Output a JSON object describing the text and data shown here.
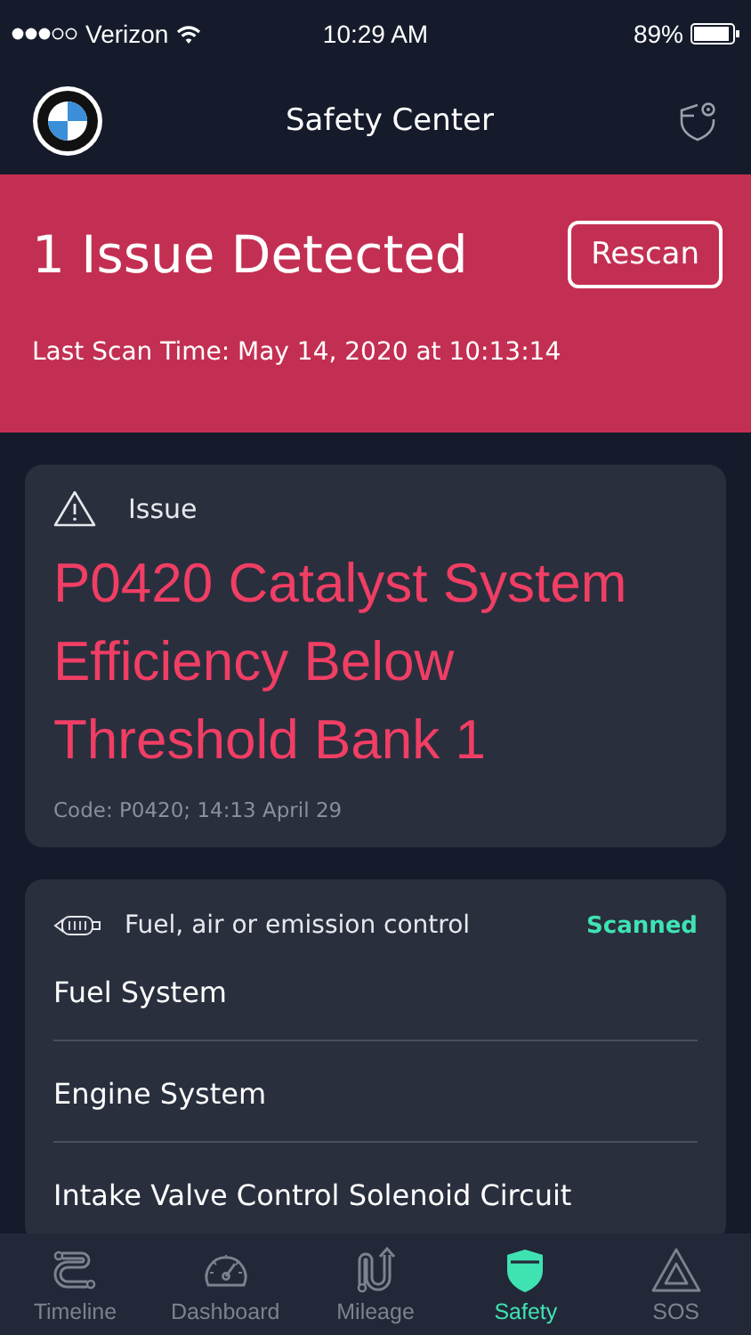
{
  "status_bar": {
    "carrier": "Verizon",
    "time": "10:29 AM",
    "battery": "89%"
  },
  "nav": {
    "title": "Safety Center"
  },
  "banner": {
    "headline": "1 Issue Detected",
    "button": "Rescan",
    "last_scan": "Last Scan Time: May 14, 2020 at 10:13:14"
  },
  "issue": {
    "label": "Issue",
    "title": "P0420 Catalyst System Efficiency Below Threshold Bank 1",
    "code": "Code: P0420; 14:13 April 29"
  },
  "category": {
    "name": "Fuel, air or emission control",
    "status": "Scanned",
    "systems": [
      "Fuel System",
      "Engine System",
      "Intake Valve Control Solenoid Circuit"
    ]
  },
  "tabs": [
    {
      "label": "Timeline",
      "selected": false
    },
    {
      "label": "Dashboard",
      "selected": false
    },
    {
      "label": "Mileage",
      "selected": false
    },
    {
      "label": "Safety",
      "selected": true
    },
    {
      "label": "SOS",
      "selected": false
    }
  ]
}
